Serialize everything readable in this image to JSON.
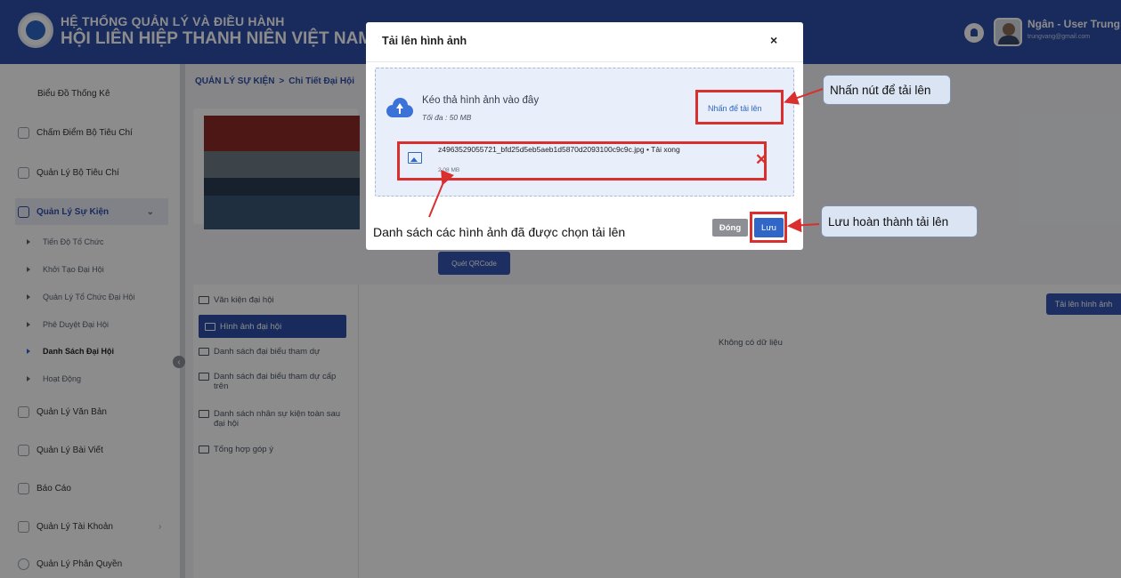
{
  "header": {
    "title_line1": "HỆ THỐNG QUẢN LÝ VÀ ĐIỀU HÀNH",
    "title_line2": "HỘI LIÊN HIỆP THANH NIÊN VIỆT NAM",
    "user_name": "Ngân - User Trung",
    "user_email": "trungvang@gmail.com"
  },
  "sidebar": {
    "items": [
      {
        "label": "Biểu Đồ Thống Kê"
      },
      {
        "label": "Chấm Điểm Bộ Tiêu Chí"
      },
      {
        "label": "Quản Lý Bộ Tiêu Chí"
      },
      {
        "label": "Quản Lý Sự Kiện"
      },
      {
        "label": "Quản Lý Văn Bản"
      },
      {
        "label": "Quản Lý Bài Viết"
      },
      {
        "label": "Báo Cáo"
      },
      {
        "label": "Quản Lý Tài Khoản"
      },
      {
        "label": "Quản Lý Phân Quyền"
      }
    ],
    "sub_items": [
      {
        "label": "Tiến Độ Tổ Chức"
      },
      {
        "label": "Khởi Tạo Đại Hội"
      },
      {
        "label": "Quản Lý Tổ Chức Đại Hội"
      },
      {
        "label": "Phê Duyệt Đại Hội"
      },
      {
        "label": "Danh Sách Đại Hội"
      },
      {
        "label": "Hoạt Động"
      }
    ]
  },
  "breadcrumb": {
    "root": "QUẢN LÝ SỰ KIỆN",
    "separator": ">",
    "current": "Chi Tiết Đại Hội"
  },
  "main": {
    "qr_button": "Quét QRCode",
    "upload_button": "Tải lên hình ảnh",
    "no_data": "Không có dữ liệu",
    "folders": [
      {
        "label": "Văn kiện đại hội"
      },
      {
        "label": "Hình ảnh đại hội"
      },
      {
        "label": "Danh sách đại biểu tham dự"
      },
      {
        "label": "Danh sách đại biểu tham dự cấp trên"
      },
      {
        "label": "Danh sách nhân sự kiện toàn sau đại hội"
      },
      {
        "label": "Tổng hợp góp ý"
      }
    ]
  },
  "modal": {
    "title": "Tải lên hình ảnh",
    "close": "×",
    "drop_text": "Kéo thả hình ảnh vào đây",
    "max_size": "Tối đa : 50 MB",
    "browse_link": "Nhấn để tải lên",
    "file": {
      "name": "z4963529055721_bfd25d5eb5aeb1d5870d2093100c9c9c.jpg • Tải xong",
      "size": "2.08 MB",
      "remove": "✕"
    },
    "btn_close": "Đóng",
    "btn_save": "Lưu"
  },
  "annotations": {
    "callout_upload": "Nhấn nút để tải lên",
    "callout_save": "Lưu hoàn thành tải lên",
    "caption_files": "Danh sách các hình ảnh đã được chọn tải lên"
  },
  "colors": {
    "brand": "#2f4fa8",
    "accent": "#2f66c7",
    "annotation_red": "#d9302f"
  }
}
